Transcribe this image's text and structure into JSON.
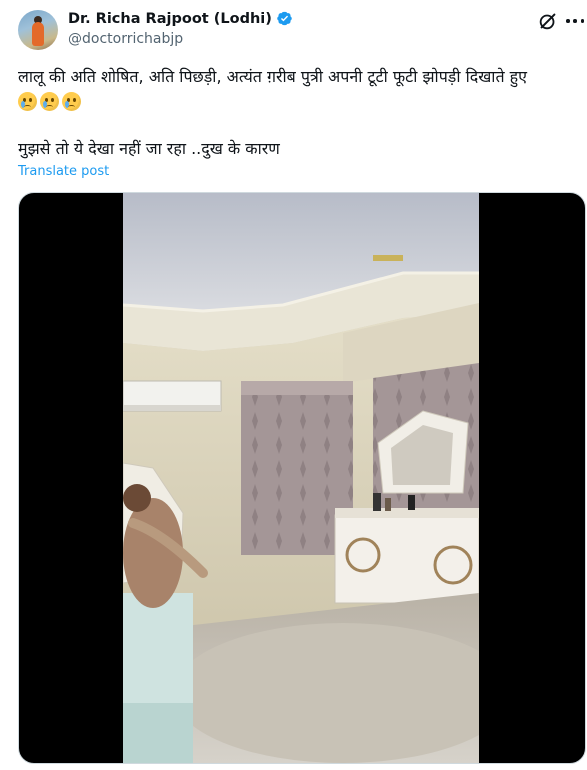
{
  "author": {
    "display_name": "Dr. Richa Rajpoot (Lodhi)",
    "handle": "@doctorrichabjp",
    "verified": true
  },
  "tweet": {
    "text_line1": "लालू की अति शोषित, अति पिछड़ी, अत्यंत ग़रीब पुत्री अपनी टूटी फूटी झोपड़ी दिखाते हुए",
    "emojis": [
      "crying-face-emoji",
      "crying-face-emoji",
      "crying-face-emoji"
    ],
    "text_line2": "मुझसे तो ये देखा नहीं जा रहा ..दुख के कारण",
    "translate_label": "Translate post"
  },
  "icons": {
    "grok": "grok-icon",
    "more": "more-options-icon"
  },
  "colors": {
    "link": "#1d9bf0",
    "verified": "#1d9bf0",
    "secondary_text": "#536471"
  }
}
